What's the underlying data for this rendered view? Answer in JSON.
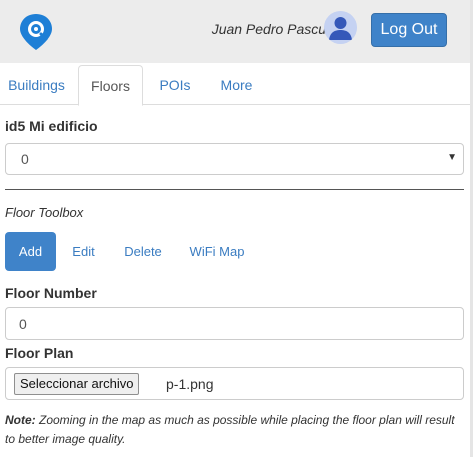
{
  "header": {
    "logo_icon": "map-pin-icon",
    "user_name": "Juan Pedro Pascual",
    "avatar_icon": "user-avatar-icon",
    "logout_label": "Log Out"
  },
  "tabs": [
    {
      "label": "Buildings",
      "active": false
    },
    {
      "label": "Floors",
      "active": true
    },
    {
      "label": "POIs",
      "active": false
    },
    {
      "label": "More",
      "active": false
    }
  ],
  "building": {
    "title": "id5 Mi edificio",
    "selected_floor": "0"
  },
  "toolbox": {
    "title": "Floor Toolbox",
    "actions": [
      {
        "label": "Add",
        "active": true
      },
      {
        "label": "Edit",
        "active": false
      },
      {
        "label": "Delete",
        "active": false
      },
      {
        "label": "WiFi Map",
        "active": false
      }
    ]
  },
  "form": {
    "floor_number_label": "Floor Number",
    "floor_number_value": "0",
    "floor_plan_label": "Floor Plan",
    "file_button_label": "Seleccionar archivo",
    "file_name": "p-1.png"
  },
  "note": {
    "prefix": "Note:",
    "text": " Zooming in the map as much as possible while placing the floor plan will result to better image quality."
  },
  "colors": {
    "accent": "#3f83c9",
    "link": "#3a7cc1",
    "header_bg": "#ececec"
  }
}
